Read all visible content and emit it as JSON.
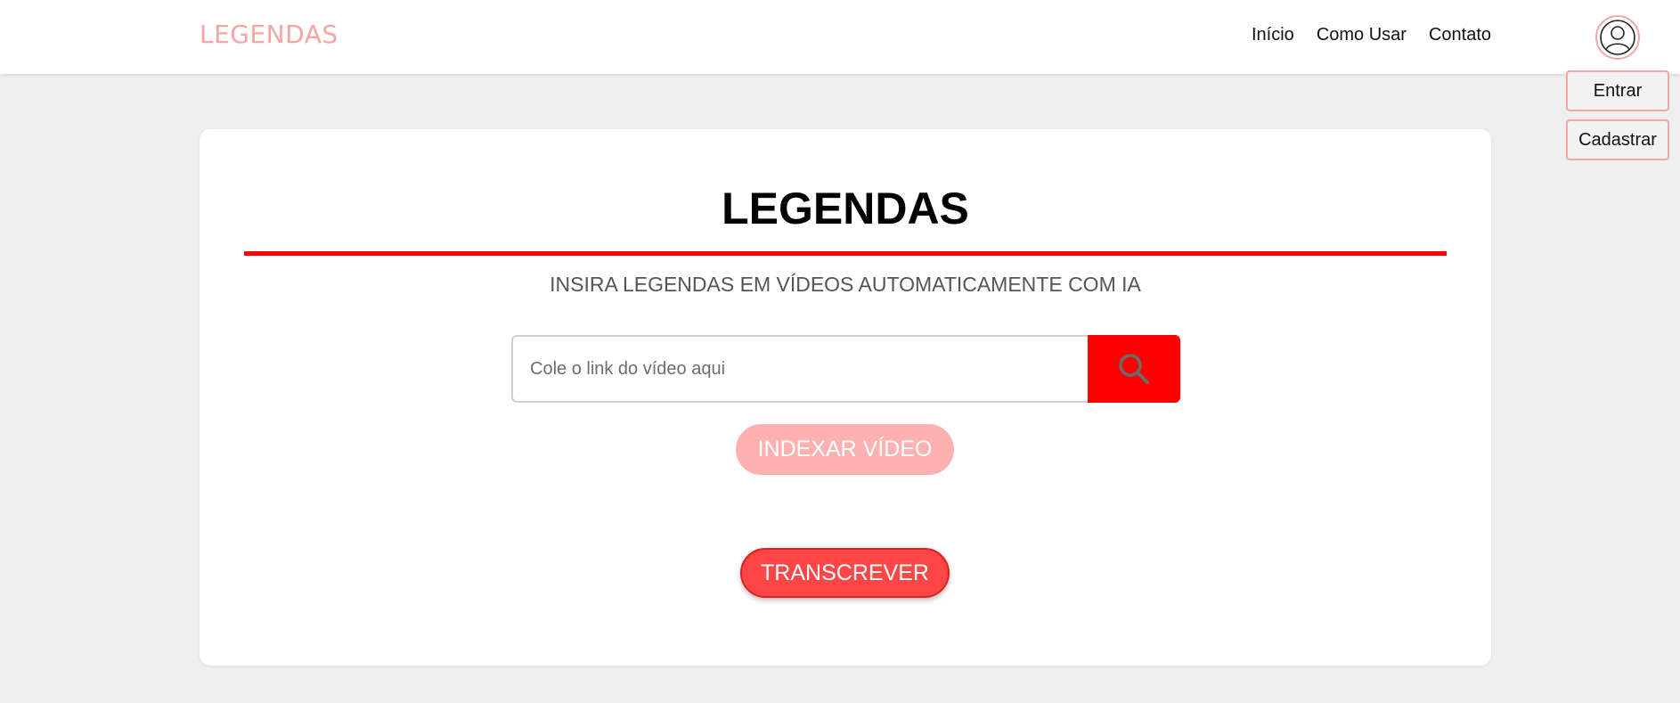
{
  "header": {
    "brand": "LEGENDAS",
    "nav": [
      {
        "label": "Início"
      },
      {
        "label": "Como Usar"
      },
      {
        "label": "Contato"
      }
    ],
    "user_icon": "user-circle-icon",
    "auth": {
      "login_label": "Entrar",
      "register_label": "Cadastrar"
    }
  },
  "main": {
    "title": "LEGENDAS",
    "subtitle": "INSIRA LEGENDAS EM VÍDEOS AUTOMATICAMENTE COM IA",
    "search": {
      "placeholder": "Cole o link do vídeo aqui",
      "value": "",
      "button_icon": "search-icon"
    },
    "index_button_label": "INDEXAR VÍDEO",
    "transcribe_button_label": "TRANSCREVER"
  },
  "colors": {
    "brand": "#f7a4a4",
    "accent": "#ff0000",
    "index_button": "#ffb0b0",
    "transcribe_button": "#ff4646",
    "page_background": "#efefef"
  }
}
